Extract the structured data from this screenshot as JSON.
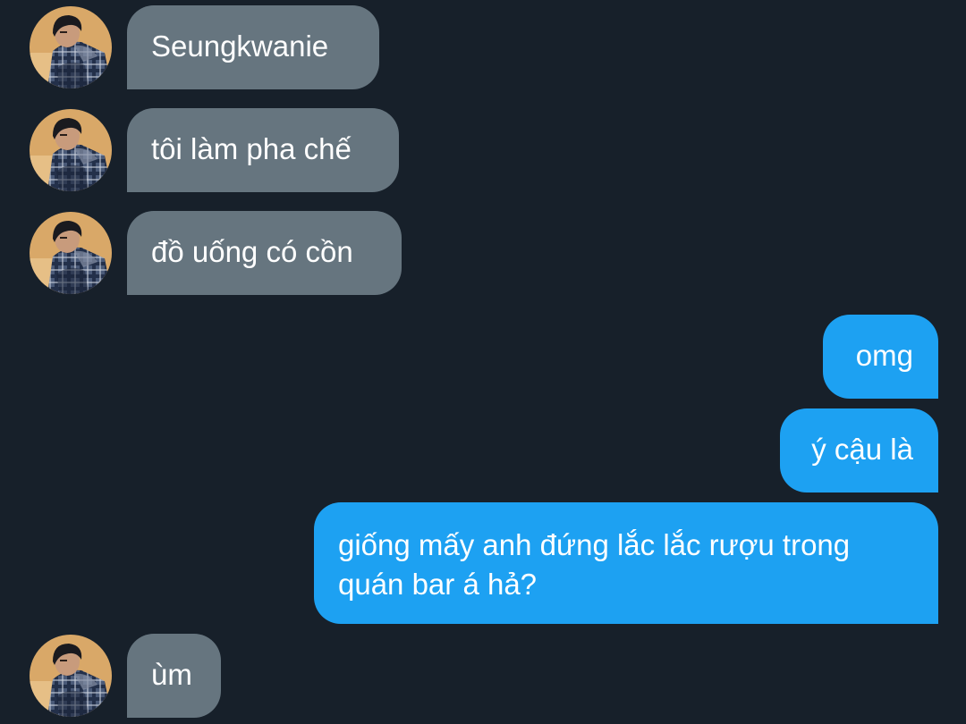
{
  "conversation": {
    "messages": [
      {
        "sender": "other",
        "text": "Seungkwanie"
      },
      {
        "sender": "other",
        "text": "tôi làm pha chế"
      },
      {
        "sender": "other",
        "text": "đồ uống có cồn"
      },
      {
        "sender": "me",
        "text": "omg"
      },
      {
        "sender": "me",
        "text": "ý cậu là"
      },
      {
        "sender": "me",
        "text": "giống mấy anh đứng lắc lắc rượu trong quán bar á hả?"
      },
      {
        "sender": "other",
        "text": "ùm"
      }
    ]
  },
  "colors": {
    "background": "#17202a",
    "incoming_bubble": "#66757f",
    "outgoing_bubble": "#1da1f2",
    "text": "#ffffff"
  },
  "icons": {
    "avatar": "contact-avatar-photo"
  }
}
